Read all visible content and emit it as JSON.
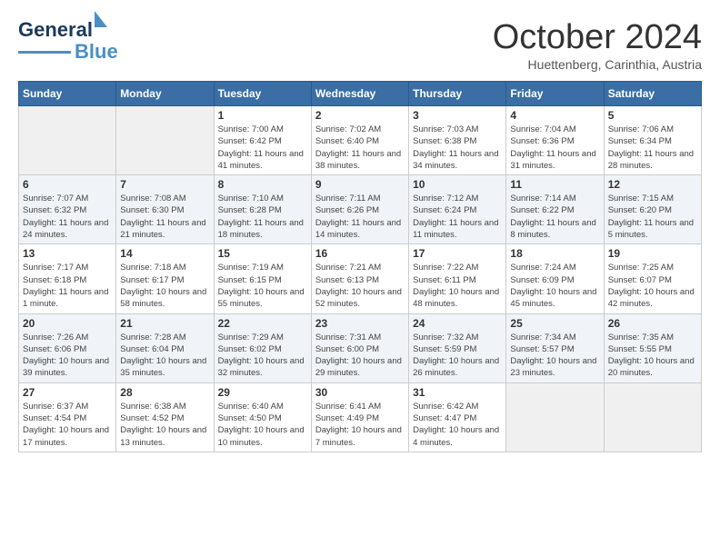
{
  "header": {
    "logo": {
      "line1": "General",
      "line2": "Blue"
    },
    "title": "October 2024",
    "location": "Huettenberg, Carinthia, Austria"
  },
  "days_of_week": [
    "Sunday",
    "Monday",
    "Tuesday",
    "Wednesday",
    "Thursday",
    "Friday",
    "Saturday"
  ],
  "weeks": [
    [
      {
        "day": "",
        "detail": ""
      },
      {
        "day": "",
        "detail": ""
      },
      {
        "day": "1",
        "detail": "Sunrise: 7:00 AM\nSunset: 6:42 PM\nDaylight: 11 hours and 41 minutes."
      },
      {
        "day": "2",
        "detail": "Sunrise: 7:02 AM\nSunset: 6:40 PM\nDaylight: 11 hours and 38 minutes."
      },
      {
        "day": "3",
        "detail": "Sunrise: 7:03 AM\nSunset: 6:38 PM\nDaylight: 11 hours and 34 minutes."
      },
      {
        "day": "4",
        "detail": "Sunrise: 7:04 AM\nSunset: 6:36 PM\nDaylight: 11 hours and 31 minutes."
      },
      {
        "day": "5",
        "detail": "Sunrise: 7:06 AM\nSunset: 6:34 PM\nDaylight: 11 hours and 28 minutes."
      }
    ],
    [
      {
        "day": "6",
        "detail": "Sunrise: 7:07 AM\nSunset: 6:32 PM\nDaylight: 11 hours and 24 minutes."
      },
      {
        "day": "7",
        "detail": "Sunrise: 7:08 AM\nSunset: 6:30 PM\nDaylight: 11 hours and 21 minutes."
      },
      {
        "day": "8",
        "detail": "Sunrise: 7:10 AM\nSunset: 6:28 PM\nDaylight: 11 hours and 18 minutes."
      },
      {
        "day": "9",
        "detail": "Sunrise: 7:11 AM\nSunset: 6:26 PM\nDaylight: 11 hours and 14 minutes."
      },
      {
        "day": "10",
        "detail": "Sunrise: 7:12 AM\nSunset: 6:24 PM\nDaylight: 11 hours and 11 minutes."
      },
      {
        "day": "11",
        "detail": "Sunrise: 7:14 AM\nSunset: 6:22 PM\nDaylight: 11 hours and 8 minutes."
      },
      {
        "day": "12",
        "detail": "Sunrise: 7:15 AM\nSunset: 6:20 PM\nDaylight: 11 hours and 5 minutes."
      }
    ],
    [
      {
        "day": "13",
        "detail": "Sunrise: 7:17 AM\nSunset: 6:18 PM\nDaylight: 11 hours and 1 minute."
      },
      {
        "day": "14",
        "detail": "Sunrise: 7:18 AM\nSunset: 6:17 PM\nDaylight: 10 hours and 58 minutes."
      },
      {
        "day": "15",
        "detail": "Sunrise: 7:19 AM\nSunset: 6:15 PM\nDaylight: 10 hours and 55 minutes."
      },
      {
        "day": "16",
        "detail": "Sunrise: 7:21 AM\nSunset: 6:13 PM\nDaylight: 10 hours and 52 minutes."
      },
      {
        "day": "17",
        "detail": "Sunrise: 7:22 AM\nSunset: 6:11 PM\nDaylight: 10 hours and 48 minutes."
      },
      {
        "day": "18",
        "detail": "Sunrise: 7:24 AM\nSunset: 6:09 PM\nDaylight: 10 hours and 45 minutes."
      },
      {
        "day": "19",
        "detail": "Sunrise: 7:25 AM\nSunset: 6:07 PM\nDaylight: 10 hours and 42 minutes."
      }
    ],
    [
      {
        "day": "20",
        "detail": "Sunrise: 7:26 AM\nSunset: 6:06 PM\nDaylight: 10 hours and 39 minutes."
      },
      {
        "day": "21",
        "detail": "Sunrise: 7:28 AM\nSunset: 6:04 PM\nDaylight: 10 hours and 35 minutes."
      },
      {
        "day": "22",
        "detail": "Sunrise: 7:29 AM\nSunset: 6:02 PM\nDaylight: 10 hours and 32 minutes."
      },
      {
        "day": "23",
        "detail": "Sunrise: 7:31 AM\nSunset: 6:00 PM\nDaylight: 10 hours and 29 minutes."
      },
      {
        "day": "24",
        "detail": "Sunrise: 7:32 AM\nSunset: 5:59 PM\nDaylight: 10 hours and 26 minutes."
      },
      {
        "day": "25",
        "detail": "Sunrise: 7:34 AM\nSunset: 5:57 PM\nDaylight: 10 hours and 23 minutes."
      },
      {
        "day": "26",
        "detail": "Sunrise: 7:35 AM\nSunset: 5:55 PM\nDaylight: 10 hours and 20 minutes."
      }
    ],
    [
      {
        "day": "27",
        "detail": "Sunrise: 6:37 AM\nSunset: 4:54 PM\nDaylight: 10 hours and 17 minutes."
      },
      {
        "day": "28",
        "detail": "Sunrise: 6:38 AM\nSunset: 4:52 PM\nDaylight: 10 hours and 13 minutes."
      },
      {
        "day": "29",
        "detail": "Sunrise: 6:40 AM\nSunset: 4:50 PM\nDaylight: 10 hours and 10 minutes."
      },
      {
        "day": "30",
        "detail": "Sunrise: 6:41 AM\nSunset: 4:49 PM\nDaylight: 10 hours and 7 minutes."
      },
      {
        "day": "31",
        "detail": "Sunrise: 6:42 AM\nSunset: 4:47 PM\nDaylight: 10 hours and 4 minutes."
      },
      {
        "day": "",
        "detail": ""
      },
      {
        "day": "",
        "detail": ""
      }
    ]
  ]
}
